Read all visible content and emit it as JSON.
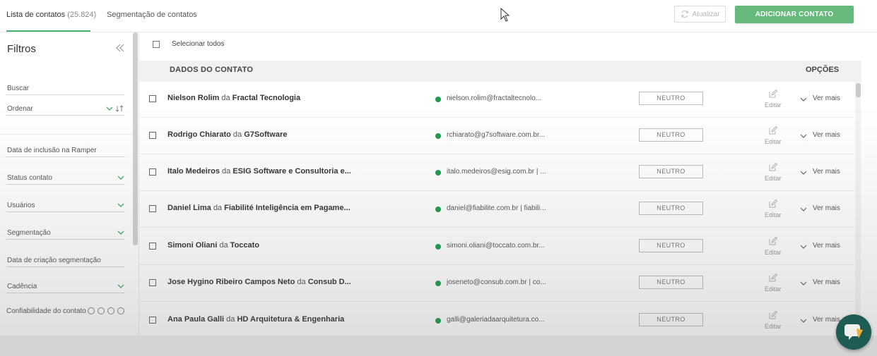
{
  "tabs": [
    {
      "label": "Lista de contatos",
      "count": "(25.824)"
    },
    {
      "label": "Segmentação de contatos"
    }
  ],
  "toolbar": {
    "refresh_label": "Atualizar",
    "add_label": "ADICIONAR CONTATO"
  },
  "sidebar": {
    "title": "Filtros",
    "search_label": "Buscar",
    "order_label": "Ordenar",
    "date_inclusion_label": "Data de inclusão na Ramper",
    "status_label": "Status contato",
    "users_label": "Usuários",
    "segmentation_label": "Segmentação",
    "seg_date_label": "Data de criação segmentação",
    "cadence_label": "Cadência",
    "confidence_label": "Confiabilidade do contato"
  },
  "list": {
    "select_all": "Selecionar todos",
    "col_contact": "DADOS DO CONTATO",
    "col_options": "OPÇÕES",
    "connector": "da",
    "edit_label": "Editar",
    "more_label": "Ver mais",
    "rows": [
      {
        "name": "Nielson Rolim",
        "company": "Fractal Tecnologia",
        "email": "nielson.rolim@fractaltecnolo...",
        "status": "NEUTRO"
      },
      {
        "name": "Rodrigo Chiarato",
        "company": "G7Software",
        "email": "rchiarato@g7software.com.br...",
        "status": "NEUTRO"
      },
      {
        "name": "Italo Medeiros",
        "company": "ESIG Software e Consultoria e...",
        "email": "italo.medeiros@esig.com.br | ...",
        "status": "NEUTRO"
      },
      {
        "name": "Daniel Lima",
        "company": "Fiabilité Inteligência em Pagame...",
        "email": "daniel@fiabilite.com.br | fiabili...",
        "status": "NEUTRO"
      },
      {
        "name": "Simoni Oliani",
        "company": "Toccato",
        "email": "simoni.oliani@toccato.com.br...",
        "status": "NEUTRO"
      },
      {
        "name": "Jose Hygino Ribeiro Campos Neto",
        "company": "Consub D...",
        "email": "joseneto@consub.com.br | co...",
        "status": "NEUTRO"
      },
      {
        "name": "Ana Paula Galli",
        "company": "HD Arquitetura & Engenharia",
        "email": "galli@galeriadaarquitetura.co...",
        "status": "NEUTRO"
      }
    ]
  },
  "colors": {
    "accent": "#66b97d",
    "status_dot": "#1e9b4c",
    "chat_widget": "#1e5b52"
  }
}
